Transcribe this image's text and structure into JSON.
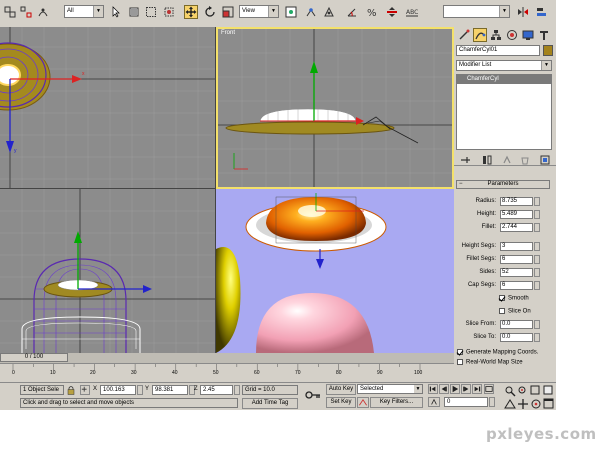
{
  "toolbar": {
    "selection_filter": "All",
    "reference_coord": "View",
    "named_selection": ""
  },
  "viewports": {
    "front_label": "Front"
  },
  "command_panel": {
    "object_name": "ChamferCyl01",
    "modifier_list": "Modifier List",
    "stack_item": "ChamferCyl",
    "rollout_title": "Parameters",
    "params": [
      {
        "label": "Radius:",
        "value": "8.735"
      },
      {
        "label": "Height:",
        "value": "5.489"
      },
      {
        "label": "Fillet:",
        "value": "2.744"
      }
    ],
    "segs": [
      {
        "label": "Height Segs:",
        "value": "3"
      },
      {
        "label": "Fillet Segs:",
        "value": "6"
      },
      {
        "label": "Sides:",
        "value": "52"
      },
      {
        "label": "Cap Segs:",
        "value": "6"
      }
    ],
    "smooth_label": "Smooth",
    "slice_on_label": "Slice On",
    "slice_from_label": "Slice From:",
    "slice_from_value": "0.0",
    "slice_to_label": "Slice To:",
    "slice_to_value": "0.0",
    "gen_mapping_label": "Generate Mapping Coords.",
    "real_world_label": "Real-World Map Size"
  },
  "timeline": {
    "frame_counter": "0 / 100",
    "ticks": [
      "0",
      "10",
      "20",
      "30",
      "40",
      "50",
      "60",
      "70",
      "80",
      "90",
      "100"
    ]
  },
  "status": {
    "selection_count": "1 Object Sele",
    "x_label": "X",
    "x_value": "100.163",
    "y_label": "Y",
    "y_value": "98.381",
    "z_label": "Z",
    "z_value": "2.45",
    "grid": "Grid = 10.0",
    "prompt": "Click and drag to select and move objects",
    "add_time_tag": "Add Time Tag",
    "auto_key": "Auto Key",
    "set_key": "Set Key",
    "key_mode": "Selected",
    "key_filters": "Key Filters...",
    "current_frame": "0"
  },
  "watermark": "pxleyes.com",
  "colors": {
    "ui_bg": "#d4d0c8",
    "viewport_bg": "#8c8c8c",
    "perspective_bg": "#a9a9f2",
    "active_border": "#f4e16a",
    "active_tool": "#f6d26b"
  }
}
